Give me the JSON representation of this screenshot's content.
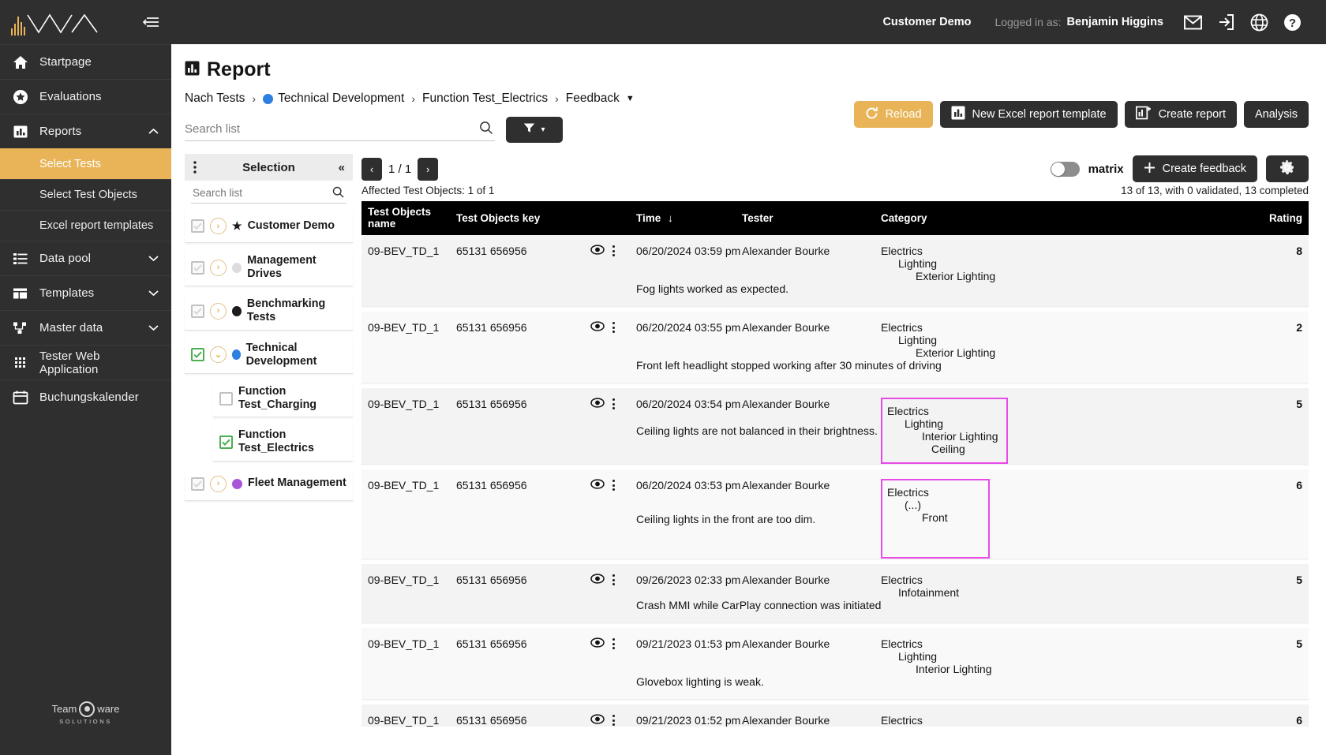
{
  "sidebar": {
    "logo_name": "tiwa-logo",
    "collapse_label": "collapse-sidebar",
    "items": [
      {
        "label": "Startpage",
        "icon": "home-icon",
        "expandable": false
      },
      {
        "label": "Evaluations",
        "icon": "star-circle-icon",
        "expandable": false
      },
      {
        "label": "Reports",
        "icon": "bar-chart-icon",
        "expandable": true,
        "expanded": true,
        "caret": "▲"
      }
    ],
    "report_subitems": [
      {
        "label": "Select Tests",
        "active": true
      },
      {
        "label": "Select Test Objects",
        "active": false
      },
      {
        "label": "Excel report templates",
        "active": false
      }
    ],
    "items_after": [
      {
        "label": "Data pool",
        "icon": "list-icon",
        "expandable": true,
        "caret": "▼"
      },
      {
        "label": "Templates",
        "icon": "layout-icon",
        "expandable": true,
        "caret": "▼"
      },
      {
        "label": "Master data",
        "icon": "sitemap-icon",
        "expandable": true,
        "caret": "▼"
      },
      {
        "label": "Tester Web Application",
        "icon": "grid-dots-icon",
        "expandable": false
      },
      {
        "label": "Buchungskalender",
        "icon": "calendar-icon",
        "expandable": false
      }
    ],
    "footer": {
      "line1a": "Team",
      "line1b": "ware",
      "line2": "SOLUTIONS"
    }
  },
  "topbar": {
    "customer": "Customer Demo",
    "logged_in_label": "Logged in as:",
    "user": "Benjamin Higgins",
    "icons": [
      "mail-icon",
      "logout-icon",
      "globe-icon",
      "help-icon"
    ]
  },
  "page": {
    "title": "Report",
    "title_icon": "report-icon",
    "breadcrumb": [
      {
        "label": "Nach Tests",
        "dot": null
      },
      {
        "label": "Technical Development",
        "dot": "#2d7fe0"
      },
      {
        "label": "Function Test_Electrics",
        "dot": null
      },
      {
        "label": "Feedback",
        "dot": null,
        "caret": true
      }
    ],
    "breadcrumb_separator": "›"
  },
  "search": {
    "placeholder": "Search list",
    "icon": "search-icon",
    "filter_icon": "filter-icon",
    "filter_caret": "▾"
  },
  "actions": {
    "reload": {
      "label": "Reload",
      "icon": "refresh-icon",
      "color": "#e8b457"
    },
    "new_excel": {
      "label": "New Excel report template",
      "icon": "bar-chart-icon"
    },
    "create_report": {
      "label": "Create report",
      "icon": "chart-plus-icon"
    },
    "analysis": {
      "label": "Analysis"
    }
  },
  "selection": {
    "title": "Selection",
    "kebab_icon": "kebab-menu-icon",
    "collapse_icon": "chevron-double-left-icon",
    "search_placeholder": "Search list",
    "tree": [
      {
        "label": "Customer Demo",
        "check": "dim",
        "expander": "›",
        "marker": "star",
        "dot": null,
        "child": false
      },
      {
        "label": "Management Drives",
        "check": "dim",
        "expander": "›",
        "marker": "dot",
        "dot": "#dcdcdc",
        "child": false
      },
      {
        "label": "Benchmarking Tests",
        "check": "dim",
        "expander": "›",
        "marker": "dot",
        "dot": "#1c1c1c",
        "child": false
      },
      {
        "label": "Technical Development",
        "check": "on",
        "expander": "˅",
        "marker": "dot",
        "dot": "#2d7fe0",
        "child": false
      },
      {
        "label": "Function Test_Charging",
        "check": "off",
        "expander": null,
        "marker": null,
        "dot": null,
        "child": true
      },
      {
        "label": "Function Test_Electrics",
        "check": "on",
        "expander": null,
        "marker": null,
        "dot": null,
        "child": true
      },
      {
        "label": "Fleet Management",
        "check": "dim",
        "expander": "›",
        "marker": "dot",
        "dot": "#a855d6",
        "child": false
      }
    ]
  },
  "toolbar": {
    "prev": "‹",
    "next": "›",
    "page_indicator": "1 / 1",
    "matrix_label": "matrix",
    "matrix_on": false,
    "create_feedback": "Create feedback",
    "create_feedback_icon": "plus-icon",
    "gear_icon": "gear-icon",
    "affected": "Affected Test Objects: 1 of 1",
    "summary": "13 of 13, with 0 validated, 13 completed"
  },
  "table": {
    "columns": [
      "Test Objects name",
      "Test Objects key",
      "",
      "Time",
      "Tester",
      "Category",
      "Rating"
    ],
    "sort_column": "Time",
    "sort_icon": "↓",
    "eye_icon": "eye-icon",
    "kebab_icon": "kebab-menu-icon",
    "rows": [
      {
        "name": "09-BEV_TD_1",
        "key": "65131 656956",
        "time": "06/20/2024 03:59 pm",
        "tester": "Alexander Bourke",
        "category": [
          "Electrics",
          "Lighting",
          "Exterior Lighting"
        ],
        "highlighted": false,
        "rating": "8",
        "comment": "Fog lights worked as expected."
      },
      {
        "name": "09-BEV_TD_1",
        "key": "65131 656956",
        "time": "06/20/2024 03:55 pm",
        "tester": "Alexander Bourke",
        "category": [
          "Electrics",
          "Lighting",
          "Exterior Lighting"
        ],
        "highlighted": false,
        "rating": "2",
        "comment": "Front left headlight stopped working after 30 minutes of driving"
      },
      {
        "name": "09-BEV_TD_1",
        "key": "65131 656956",
        "time": "06/20/2024 03:54 pm",
        "tester": "Alexander Bourke",
        "category": [
          "Electrics",
          "Lighting",
          "Interior Lighting",
          "Ceiling"
        ],
        "highlighted": true,
        "rating": "5",
        "comment": "Ceiling lights are not balanced in their brightness."
      },
      {
        "name": "09-BEV_TD_1",
        "key": "65131 656956",
        "time": "06/20/2024 03:53 pm",
        "tester": "Alexander Bourke",
        "category": [
          "Electrics",
          "(...)",
          "Front"
        ],
        "highlighted": true,
        "rating": "6",
        "comment": "Ceiling lights in the front are too dim."
      },
      {
        "name": "09-BEV_TD_1",
        "key": "65131 656956",
        "time": "09/26/2023 02:33 pm",
        "tester": "Alexander Bourke",
        "category": [
          "Electrics",
          "Infotainment"
        ],
        "highlighted": false,
        "rating": "5",
        "comment": "Crash MMI while CarPlay connection was initiated"
      },
      {
        "name": "09-BEV_TD_1",
        "key": "65131 656956",
        "time": "09/21/2023 01:53 pm",
        "tester": "Alexander Bourke",
        "category": [
          "Electrics",
          "Lighting",
          "Interior Lighting"
        ],
        "highlighted": false,
        "rating": "5",
        "comment": "Glovebox lighting is weak."
      },
      {
        "name": "09-BEV_TD_1",
        "key": "65131 656956",
        "time": "09/21/2023 01:52 pm",
        "tester": "Alexander Bourke",
        "category": [
          "Electrics"
        ],
        "highlighted": false,
        "rating": "6",
        "comment": ""
      }
    ]
  },
  "colors": {
    "accent": "#e8b457",
    "dark": "#2f2f2f",
    "highlight": "#e84ae8",
    "green": "#4caf50"
  }
}
